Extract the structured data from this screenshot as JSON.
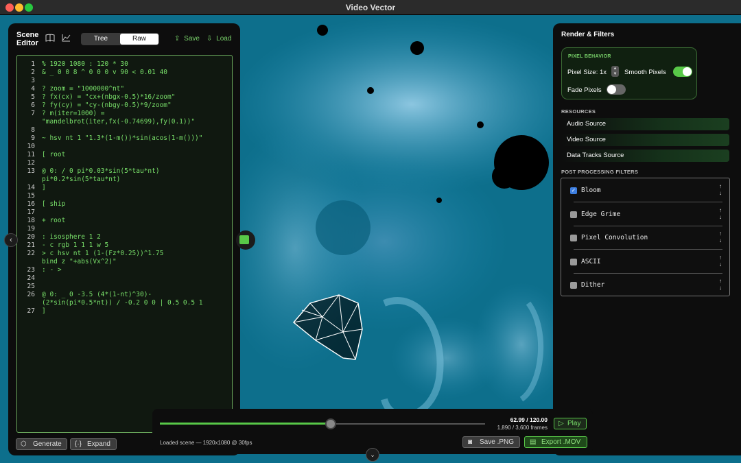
{
  "window": {
    "title": "Video Vector"
  },
  "left": {
    "title": "Scene Editor",
    "icons": [
      "book-icon",
      "chart-icon"
    ],
    "tabs": [
      {
        "label": "Tree",
        "active": false
      },
      {
        "label": "Raw",
        "active": true
      }
    ],
    "save_label": "Save",
    "load_label": "Load",
    "code": [
      {
        "n": "1",
        "t": "% 1920 1080 : 120 * 30"
      },
      {
        "n": "2",
        "t": "& _ 0 0 8 ^ 0 0 0 v 90 < 0.01 40"
      },
      {
        "n": "3",
        "t": ""
      },
      {
        "n": "4",
        "t": "? zoom = \"1000000^nt\""
      },
      {
        "n": "5",
        "t": "? fx(cx) = \"cx+(nbgx-0.5)*16/zoom\""
      },
      {
        "n": "6",
        "t": "? fy(cy) = \"cy-(nbgy-0.5)*9/zoom\""
      },
      {
        "n": "7",
        "t": "? m(iter=1000) ="
      },
      {
        "n": "",
        "t": "\"mandelbrot(iter,fx(-0.74699),fy(0.1))\""
      },
      {
        "n": "8",
        "t": ""
      },
      {
        "n": "9",
        "t": "~ hsv nt 1 \"1.3*(1-m())*sin(acos(1-m()))\""
      },
      {
        "n": "10",
        "t": ""
      },
      {
        "n": "11",
        "t": "[ root"
      },
      {
        "n": "12",
        "t": ""
      },
      {
        "n": "13",
        "t": "@ 0: / 0 pi*0.03*sin(5*tau*nt)"
      },
      {
        "n": "",
        "t": "pi*0.2*sin(5*tau*nt)"
      },
      {
        "n": "14",
        "t": "]"
      },
      {
        "n": "15",
        "t": ""
      },
      {
        "n": "16",
        "t": "[ ship"
      },
      {
        "n": "17",
        "t": ""
      },
      {
        "n": "18",
        "t": "+ root"
      },
      {
        "n": "19",
        "t": ""
      },
      {
        "n": "20",
        "t": ": isosphere 1 2"
      },
      {
        "n": "21",
        "t": "- c rgb 1 1 1 w 5"
      },
      {
        "n": "22",
        "t": "> c hsv nt 1 (1-(Fz*0.25))^1.75"
      },
      {
        "n": "",
        "t": "bind z \"+abs(Vx^2)\""
      },
      {
        "n": "23",
        "t": ": - >"
      },
      {
        "n": "24",
        "t": ""
      },
      {
        "n": "25",
        "t": ""
      },
      {
        "n": "26",
        "t": "@ 0: _ 0 -3.5 (4*(1-nt)^30)-"
      },
      {
        "n": "",
        "t": "(2*sin(pi*0.5*nt)) / -0.2 0 0 | 0.5 0.5 1"
      },
      {
        "n": "27",
        "t": "]"
      }
    ],
    "generate_label": "Generate",
    "expand_label": "Expand"
  },
  "right": {
    "title": "Render & Filters",
    "pixel_behavior": {
      "heading": "PIXEL BEHAVIOR",
      "pixel_size_label": "Pixel Size: 1x",
      "smooth_label": "Smooth Pixels",
      "smooth_on": true,
      "fade_label": "Fade Pixels",
      "fade_on": false
    },
    "resources_heading": "RESOURCES",
    "resources": [
      "Audio Source",
      "Video Source",
      "Data Tracks Source"
    ],
    "filters_heading": "POST PROCESSING FILTERS",
    "filters": [
      {
        "name": "Bloom",
        "checked": true
      },
      {
        "name": "Edge Grime",
        "checked": false
      },
      {
        "name": "Pixel Convolution",
        "checked": false
      },
      {
        "name": "ASCII",
        "checked": false
      },
      {
        "name": "Dither",
        "checked": false
      }
    ]
  },
  "playback": {
    "progress": 0.525,
    "time": "62.99 / 120.00",
    "frames": "1,890 / 3,600 frames",
    "play_label": "Play",
    "status": "Loaded scene — 1920x1080 @ 30fps",
    "save_png_label": "Save .PNG",
    "export_mov_label": "Export .MOV"
  },
  "colors": {
    "accent": "#58c848",
    "canvas_bg": "#0f6d88",
    "panel_bg": "#0d0d0d"
  }
}
